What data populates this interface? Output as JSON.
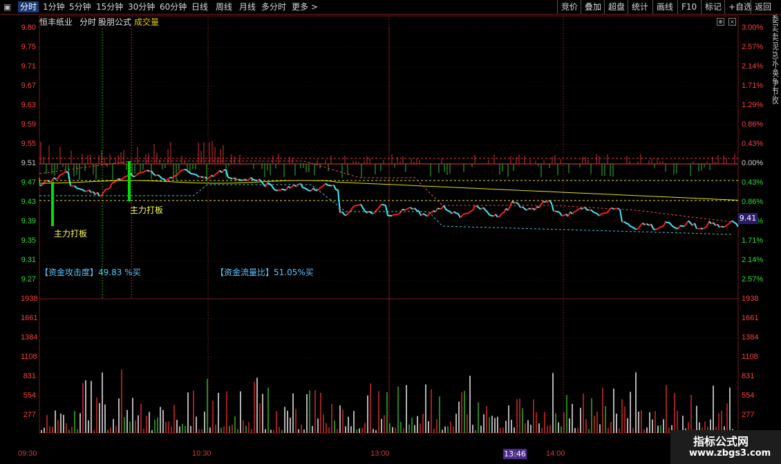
{
  "toolbar": {
    "items": [
      "分时",
      "1分钟",
      "5分钟",
      "15分钟",
      "30分钟",
      "60分钟",
      "日线",
      "周线",
      "月线",
      "多分时",
      "更多 >"
    ],
    "right": [
      "竞价",
      "叠加",
      "超盘",
      "统计",
      "画线",
      "F10",
      "标记",
      "+自选",
      "返回"
    ]
  },
  "chart": {
    "stock_name": "恒丰纸业",
    "tab1": "分时",
    "formula": "股朋公式",
    "indicator": "成交量",
    "price_ticks": [
      "9.80",
      "9.75",
      "9.71",
      "9.67",
      "9.63",
      "9.59",
      "9.55",
      "9.51",
      "9.47",
      "9.43",
      "9.39",
      "9.35",
      "9.31",
      "9.27"
    ],
    "pct_ticks": [
      "3.00%",
      "2.57%",
      "2.14%",
      "1.71%",
      "1.29%",
      "0.86%",
      "0.43%",
      "0.00%",
      "0.43%",
      "0.86%",
      "1.29%",
      "1.71%",
      "2.14%",
      "2.57%"
    ],
    "volume_ticks": [
      "1938",
      "1661",
      "1384",
      "1108",
      "831",
      "554",
      "277"
    ],
    "time_ticks": [
      "09:30",
      "10:30",
      "13:00",
      "14:00"
    ],
    "cursor_time": "13:46",
    "current_price": "9.41",
    "annotations": [
      "主力打板",
      "主力打板"
    ],
    "attack_label": "【资金攻击度】49.83 %买",
    "flow_label": "【资金流量比】51.05%买"
  },
  "side_strip": "委买卖现总外换净市收",
  "watermark": {
    "line1": "指标公式网",
    "line2": "www.zbgs3.com"
  },
  "colors": {
    "up": "#ff3232",
    "down": "#00e0e0",
    "avg": "#e6e600",
    "grid": "#7a1b1b",
    "green": "#00d000"
  }
}
